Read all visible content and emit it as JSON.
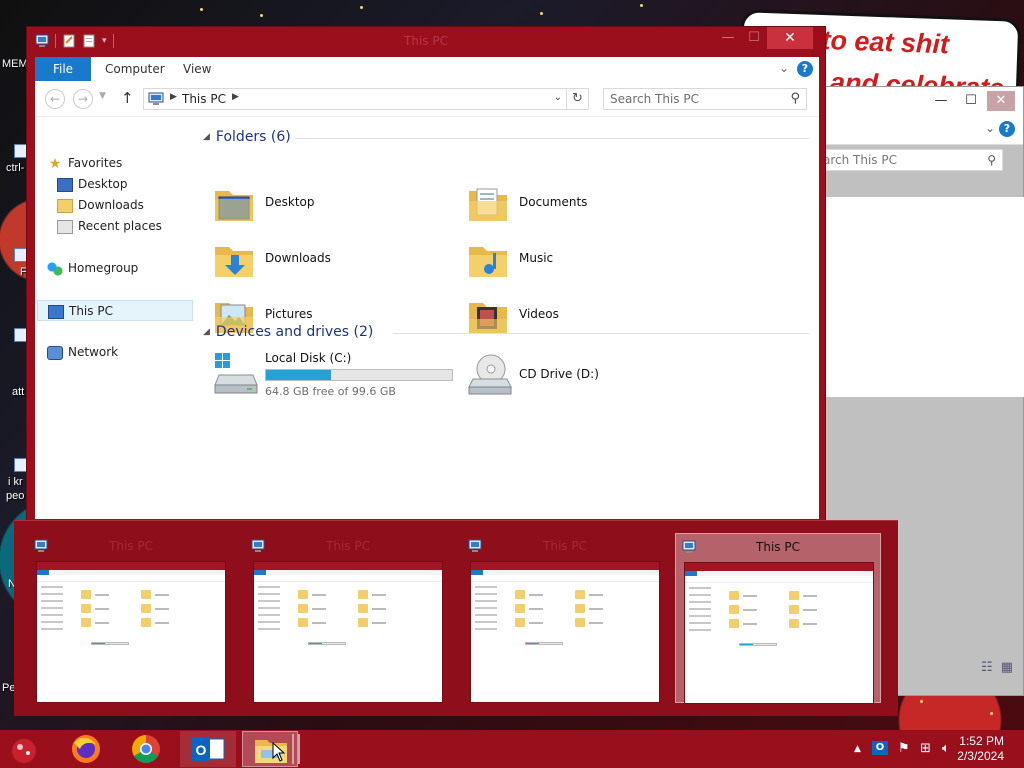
{
  "desktop": {
    "banner_line1": "to eat shit",
    "banner_line2": "and celebrate",
    "labels": [
      "MEM",
      "ctrl-",
      "F",
      "att",
      "i kr",
      "peo",
      "N",
      "Pe"
    ]
  },
  "background_window": {
    "search_placeholder": "Search This PC",
    "controls": {
      "minimize": "—",
      "maximize": "☐",
      "close": "✕"
    }
  },
  "window": {
    "title": "This PC",
    "controls": {
      "minimize": "—",
      "maximize": "☐",
      "close": "✕"
    },
    "ribbon": {
      "tabs": [
        "File",
        "Computer",
        "View"
      ],
      "help": "?"
    },
    "address": {
      "path": "This PC",
      "search_placeholder": "Search This PC"
    },
    "nav_pane": {
      "favorites": "Favorites",
      "favorites_items": [
        "Desktop",
        "Downloads",
        "Recent places"
      ],
      "homegroup": "Homegroup",
      "this_pc": "This PC",
      "network": "Network"
    },
    "content": {
      "folders_header": "Folders (6)",
      "folders": [
        {
          "name": "Desktop",
          "icon": "desktop-folder-icon"
        },
        {
          "name": "Documents",
          "icon": "documents-folder-icon"
        },
        {
          "name": "Downloads",
          "icon": "downloads-folder-icon"
        },
        {
          "name": "Music",
          "icon": "music-folder-icon"
        },
        {
          "name": "Pictures",
          "icon": "pictures-folder-icon"
        },
        {
          "name": "Videos",
          "icon": "videos-folder-icon"
        }
      ],
      "drives_header": "Devices and drives (2)",
      "drives": [
        {
          "name": "Local Disk (C:)",
          "free": "64.8 GB free of 99.6 GB",
          "used_fraction": 0.35,
          "icon": "hard-drive-icon"
        },
        {
          "name": "CD Drive (D:)",
          "icon": "cd-drive-icon"
        }
      ]
    }
  },
  "switcher": {
    "thumbnails": [
      {
        "title": "This PC",
        "selected": false
      },
      {
        "title": "This PC",
        "selected": false
      },
      {
        "title": "This PC",
        "selected": false
      },
      {
        "title": "This PC",
        "selected": true
      }
    ]
  },
  "taskbar": {
    "apps": [
      "start-orb-icon",
      "firefox-icon",
      "chrome-icon",
      "outlook-icon",
      "file-explorer-icon"
    ],
    "clock_time": "1:52 PM",
    "clock_date": "2/3/2024"
  },
  "colors": {
    "window_frame": "#9b0f1d",
    "accent_blue": "#1979ca",
    "drive_fill": "#26a0da",
    "group_header": "#1e3287"
  }
}
